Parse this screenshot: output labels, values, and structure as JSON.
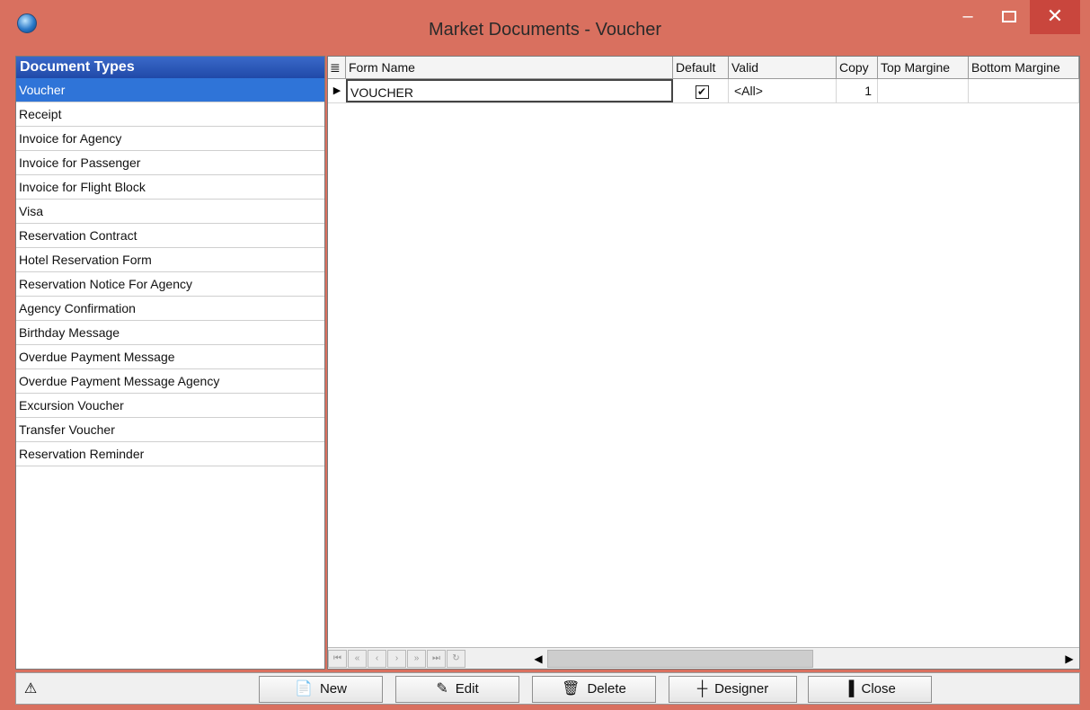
{
  "window": {
    "title": "Market Documents - Voucher",
    "min_glyph": "–",
    "close_glyph": "✕"
  },
  "left_panel": {
    "header": "Document Types",
    "items": [
      "Voucher",
      "Receipt",
      "Invoice for Agency",
      "Invoice for Passenger",
      "Invoice for Flight Block",
      "Visa",
      "Reservation Contract",
      "Hotel Reservation  Form",
      "Reservation Notice For Agency",
      "Agency Confirmation",
      "Birthday Message",
      "Overdue Payment Message",
      "Overdue Payment Message Agency",
      "Excursion Voucher",
      "Transfer Voucher",
      "Reservation Reminder"
    ],
    "selected_index": 0
  },
  "grid": {
    "columns": [
      "Form Name",
      "Default",
      "Valid",
      "Copy",
      "Top Margine",
      "Bottom Margine"
    ],
    "rows": [
      {
        "form_name": "VOUCHER",
        "default": true,
        "valid": "<All>",
        "copy": "1",
        "top_margine": "",
        "bottom_margine": ""
      }
    ]
  },
  "navigator": {
    "buttons": [
      "first-icon",
      "prior-page-icon",
      "prior-icon",
      "next-icon",
      "next-page-icon",
      "last-icon",
      "refresh-icon"
    ],
    "glyphs": [
      "⏮",
      "«",
      "‹",
      "›",
      "»",
      "⏭",
      "↻"
    ],
    "arrow_left": "◀",
    "arrow_right": "▶"
  },
  "toolbar": {
    "new_label": "New",
    "edit_label": "Edit",
    "delete_label": "Delete",
    "designer_label": "Designer",
    "close_label": "Close",
    "icons": {
      "new": "📄",
      "edit": "✎",
      "delete": "🗑",
      "designer": "┼",
      "close": "▐",
      "status": "⚠"
    }
  }
}
